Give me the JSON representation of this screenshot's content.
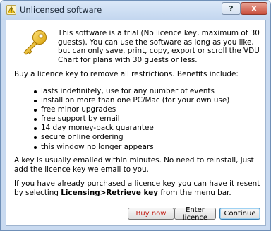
{
  "window": {
    "title": "Unlicensed software",
    "help_label": "?",
    "close_label": "X"
  },
  "colors": {
    "buy_now_text": "#c21b12",
    "title_bar": "#c9daf0"
  },
  "content": {
    "intro": "This software is a trial (No licence key, maximum of 30 guests). You can use the software as long as you like, but can only save, print, copy, export or scroll the VDU Chart for plans with 30 guests or less.",
    "benefits_heading": "Buy a licence key to remove all restrictions. Benefits include:",
    "benefits": [
      "lasts indefinitely, use for any number of events",
      "install on more than one PC/Mac (for your own use)",
      "free minor upgrades",
      "free support by email",
      "14 day money-back guarantee",
      "secure online ordering",
      "this window no longer appears"
    ],
    "email_note": "A key is usually emailed within minutes. No need to reinstall, just add the licence key we email to you.",
    "resend_prefix": "If you have already purchased a licence key you can have it resent by selecting ",
    "resend_menu": "Licensing>Retrieve key",
    "resend_suffix": " from the menu bar."
  },
  "buttons": {
    "buy_now": "Buy now",
    "enter_licence": "Enter licence",
    "continue": "Continue"
  }
}
